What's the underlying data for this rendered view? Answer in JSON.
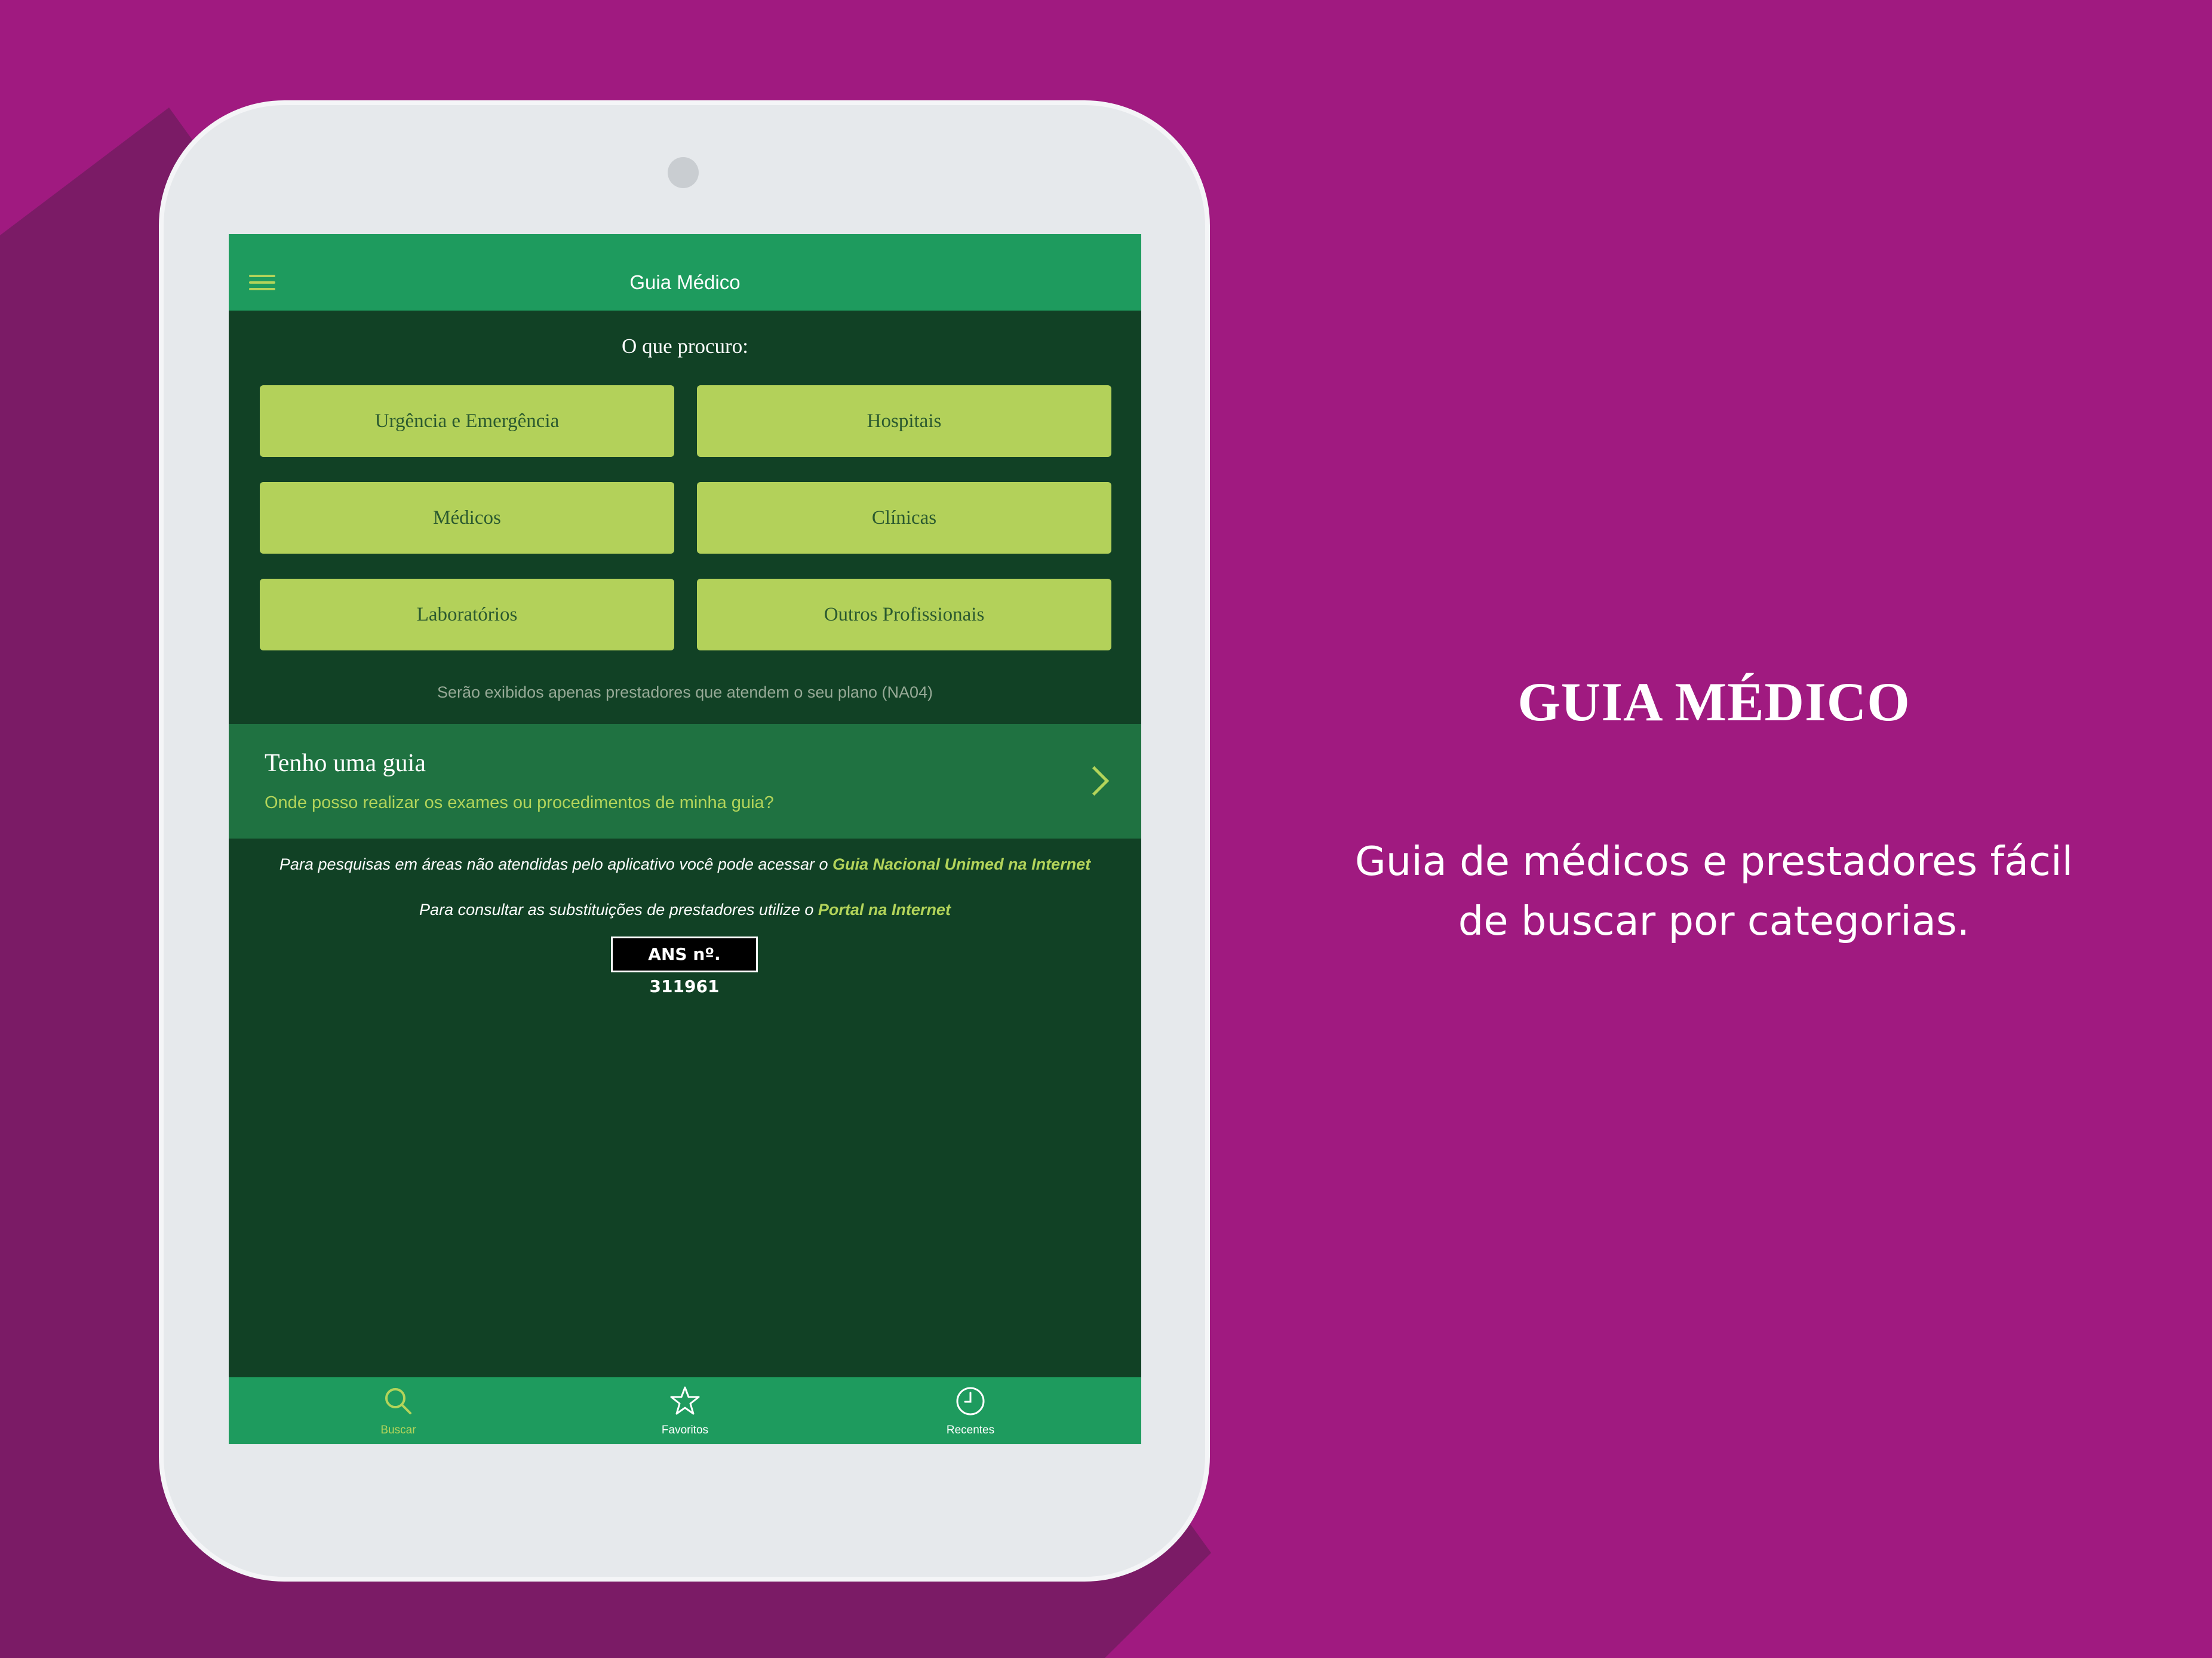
{
  "colors": {
    "background": "#a01a80",
    "app_green": "#1e9b5e",
    "app_dark": "#114125",
    "accent_lime": "#b3d15a"
  },
  "app": {
    "title": "Guia Médico",
    "menu_icon": "hamburger-menu-icon"
  },
  "search": {
    "question": "O que procuro:",
    "categories": [
      "Urgência e Emergência",
      "Hospitais",
      "Médicos",
      "Clínicas",
      "Laboratórios",
      "Outros Profissionais"
    ],
    "note": "Serão exibidos apenas prestadores que atendem o seu plano (NA04)"
  },
  "guia": {
    "title": "Tenho uma guia",
    "subtitle": "Onde posso realizar os exames ou procedimentos de minha guia?",
    "icon": "chevron-right-icon"
  },
  "info": {
    "line1_text": "Para pesquisas em áreas não atendidas pelo aplicativo você pode acessar o ",
    "line1_link": "Guia Nacional Unimed na Internet",
    "line2_text": "Para consultar as substituições de prestadores utilize o ",
    "line2_link": "Portal na Internet",
    "ans": "ANS nº. 311961"
  },
  "tabs": [
    {
      "label": "Buscar",
      "icon": "search-icon",
      "active": true
    },
    {
      "label": "Favoritos",
      "icon": "star-icon",
      "active": false
    },
    {
      "label": "Recentes",
      "icon": "clock-icon",
      "active": false
    }
  ],
  "promo": {
    "headline": "GUIA MÉDICO",
    "description": "Guia de médicos e prestadores fácil de buscar por categorias."
  }
}
